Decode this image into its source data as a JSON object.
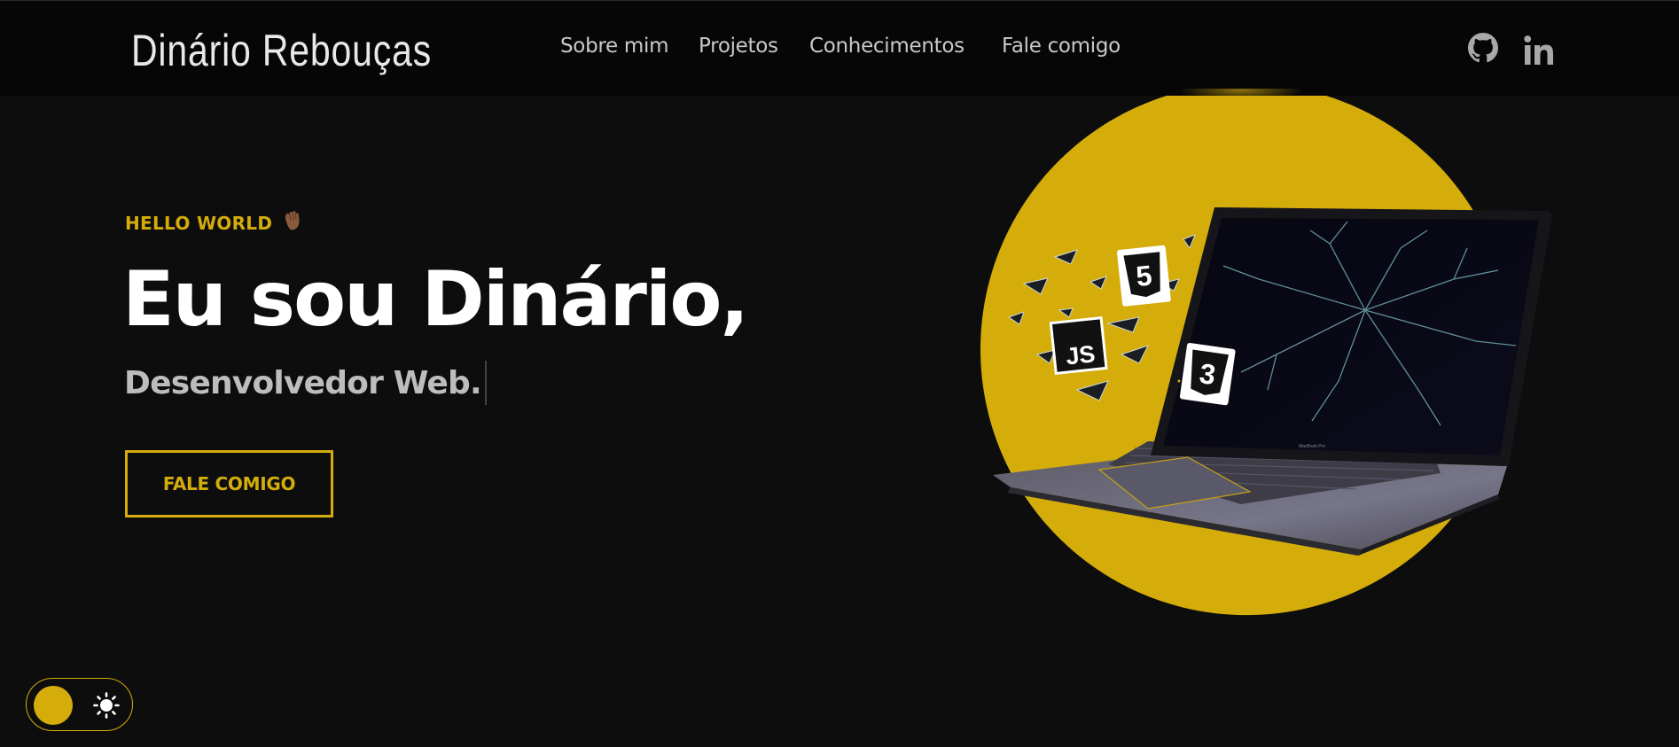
{
  "header": {
    "logo": "Dinário Rebouças",
    "nav": [
      {
        "label": "Sobre mim"
      },
      {
        "label": "Projetos"
      },
      {
        "label": "Conhecimentos"
      },
      {
        "label": "Fale comigo"
      }
    ],
    "social": [
      {
        "icon": "github-icon"
      },
      {
        "icon": "linkedin-icon"
      }
    ]
  },
  "hero": {
    "greeting": "HELLO WORLD",
    "greeting_emoji": "👋🏾",
    "title": "Eu sou Dinário,",
    "subtitle": "Desenvolvedor Web.",
    "cta_label": "FALE COMIGO"
  },
  "illustration": {
    "badges": [
      "5",
      "JS",
      "3"
    ],
    "laptop_label": "MacBook Pro"
  },
  "theme_toggle": {
    "icon": "sun-icon",
    "state": "dark"
  },
  "colors": {
    "accent": "#d4ad0b",
    "background": "#0d0d0d",
    "header": "#060606",
    "text": "#ffffff",
    "muted": "#bdbdbd"
  }
}
